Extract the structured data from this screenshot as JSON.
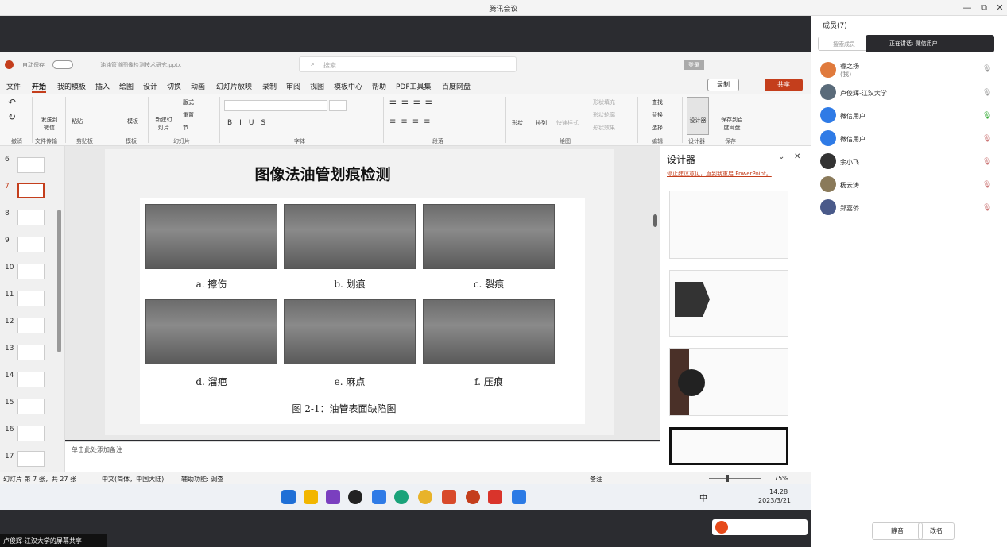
{
  "meeting": {
    "title": "腾讯会议",
    "minimize": "—",
    "restore": "⧉",
    "close": "✕"
  },
  "ppt": {
    "autosave": "自动保存",
    "filename": "油油管道图像检测技术研究.pptx",
    "search_placeholder": "搜索",
    "login_label": "登录",
    "menu": [
      "文件",
      "开始",
      "我的模板",
      "插入",
      "绘图",
      "设计",
      "切换",
      "动画",
      "幻灯片放映",
      "录制",
      "审阅",
      "视图",
      "模板中心",
      "帮助",
      "PDF工具集",
      "百度网盘"
    ],
    "record_button": "录制",
    "share_button": "共享",
    "ribbon": {
      "undo_group": "撤消",
      "send_label": "发送到微信",
      "transfer_group": "文件传输",
      "paste_label": "粘贴",
      "clipboard_group": "剪贴板",
      "template_label": "模板",
      "template_group": "模板",
      "new_slide_label": "新建幻灯片",
      "layout_label": "版式",
      "reset_label": "重置",
      "section_label": "节",
      "slides_group": "幻灯片",
      "font_group": "字体",
      "paragraph_group": "段落",
      "shape_label": "形状",
      "arrange_label": "排列",
      "quickstyle_label": "快速样式",
      "fill_label": "形状填充",
      "outline_label": "形状轮廓",
      "effect_label": "形状效果",
      "drawing_group": "绘图",
      "find_label": "查找",
      "replace_label": "替换",
      "select_label": "选择",
      "editing_group": "编辑",
      "designer_label": "设计器",
      "designer_group": "设计器",
      "save_baidu_label": "保存到百度网盘",
      "save_group": "保存"
    },
    "thumb_numbers": [
      "6",
      "7",
      "8",
      "9",
      "10",
      "11",
      "12",
      "13",
      "14",
      "15",
      "16",
      "17"
    ],
    "slide": {
      "title": "图像法油管划痕检测",
      "captions": [
        "a. 擦伤",
        "b. 划痕",
        "c. 裂痕",
        "d. 溜疤",
        "e. 麻点",
        "f. 压痕"
      ],
      "figure_caption": "图 2-1：油管表面缺陷图"
    },
    "notes_placeholder": "单击此处添加备注",
    "designer": {
      "title": "设计器",
      "link": "停止建议意见，直到我重启 PowerPoint。"
    },
    "status": {
      "slide_info": "幻灯片 第 7 张，共 27 张",
      "language": "中文(简体，中国大陆)",
      "accessibility": "辅助功能: 调查",
      "notes": "备注",
      "zoom": "75%"
    }
  },
  "taskbar": {
    "ime": "中",
    "time": "14:28",
    "date": "2023/3/21"
  },
  "sharing": {
    "label": "卢俊辉-江汉大学的屏幕共享"
  },
  "members": {
    "title": "成员(7)",
    "search_placeholder": "搜索成员",
    "speaking": "正在讲话: 微信用户",
    "list": [
      {
        "name": "睿之扬",
        "sub": "(我)",
        "color": "#e07a3c"
      },
      {
        "name": "卢俊辉-江汉大学",
        "sub": "",
        "color": "#5a6b7a"
      },
      {
        "name": "微信用户",
        "sub": "",
        "color": "#2f7be6"
      },
      {
        "name": "微信用户",
        "sub": "",
        "color": "#2f7be6"
      },
      {
        "name": "余小飞",
        "sub": "",
        "color": "#333"
      },
      {
        "name": "杨云涛",
        "sub": "",
        "color": "#8a7a5a"
      },
      {
        "name": "郑嘉侨",
        "sub": "",
        "color": "#4a5a8a"
      }
    ],
    "mute_all": "静音",
    "rename": "改名"
  }
}
